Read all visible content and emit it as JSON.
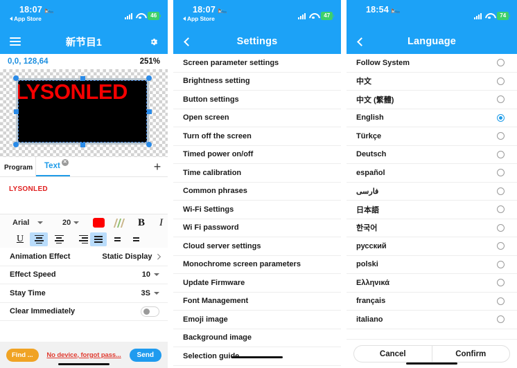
{
  "panel_editor": {
    "status_bar": {
      "time": "18:07",
      "back_label": "App Store",
      "battery": "46",
      "bed_icon": "bed-icon"
    },
    "nav": {
      "title": "新节目1",
      "menu_icon": "hamburger-icon",
      "settings_icon": "gear-icon"
    },
    "canvas": {
      "coordinates": "0,0, 128,64",
      "zoom": "251%",
      "led_text": "LYSONLED"
    },
    "tabs": {
      "program_label": "Program",
      "text_label": "Text",
      "close_icon": "close-icon",
      "add_label": "+"
    },
    "text_value": "LYSONLED",
    "format_toolbar": {
      "font": "Arial",
      "size": "20",
      "color": "#FE0000",
      "gradient_icon": "gradient-stripes-icon",
      "bold": "B",
      "italic": "I",
      "underline": "U",
      "align_left_icon": "align-left-icon",
      "align_center_icon": "align-center-icon",
      "align_right_icon": "align-right-icon",
      "valign_middle_icon": "valign-middle-icon",
      "valign_top_icon": "valign-top-icon",
      "valign_bottom_icon": "valign-bottom-icon"
    },
    "options": [
      {
        "label": "Animation Effect",
        "value": "Static Display",
        "control": "chevron"
      },
      {
        "label": "Effect Speed",
        "value": "10",
        "control": "caret"
      },
      {
        "label": "Stay Time",
        "value": "3S",
        "control": "caret"
      },
      {
        "label": "Clear Immediately",
        "value": "",
        "control": "toggle"
      }
    ],
    "action_bar": {
      "find_label": "Find ...",
      "no_device_label": "No device, forgot pass...",
      "send_label": "Send"
    }
  },
  "panel_settings": {
    "status_bar": {
      "time": "18:07",
      "back_label": "App Store",
      "battery": "47",
      "bed_icon": "bed-icon"
    },
    "nav": {
      "title": "Settings",
      "back_icon": "chevron-left-icon"
    },
    "items": [
      "Screen parameter settings",
      "Brightness setting",
      "Button settings",
      "Open screen",
      "Turn off the screen",
      "Timed power on/off",
      "Time calibration",
      "Common phrases",
      "Wi-Fi Settings",
      "Wi Fi password",
      "Cloud server settings",
      "Monochrome screen parameters",
      "Update Firmware",
      "Font Management",
      "Emoji image",
      "Background image",
      "Selection guide"
    ]
  },
  "panel_language": {
    "status_bar": {
      "time": "18:54",
      "battery": "74",
      "bed_icon": "bed-icon"
    },
    "nav": {
      "title": "Language",
      "back_icon": "chevron-left-icon"
    },
    "languages": [
      {
        "label": "Follow System",
        "selected": false
      },
      {
        "label": "中文",
        "selected": false
      },
      {
        "label": "中文 (繁體)",
        "selected": false
      },
      {
        "label": "English",
        "selected": true
      },
      {
        "label": "Türkçe",
        "selected": false
      },
      {
        "label": "Deutsch",
        "selected": false
      },
      {
        "label": "español",
        "selected": false
      },
      {
        "label": "فارسی",
        "selected": false
      },
      {
        "label": "日本語",
        "selected": false
      },
      {
        "label": "한국어",
        "selected": false
      },
      {
        "label": "русский",
        "selected": false
      },
      {
        "label": "polski",
        "selected": false
      },
      {
        "label": "Ελληνικά",
        "selected": false
      },
      {
        "label": "français",
        "selected": false
      },
      {
        "label": "italiano",
        "selected": false
      }
    ],
    "footer": {
      "cancel_label": "Cancel",
      "confirm_label": "Confirm"
    }
  },
  "colors": {
    "accent_blue": "#1CA2F7",
    "led_red": "#F40000",
    "battery_green": "#3ED06A",
    "warning_orange": "#F0A324",
    "error_red": "#E03A2F"
  }
}
